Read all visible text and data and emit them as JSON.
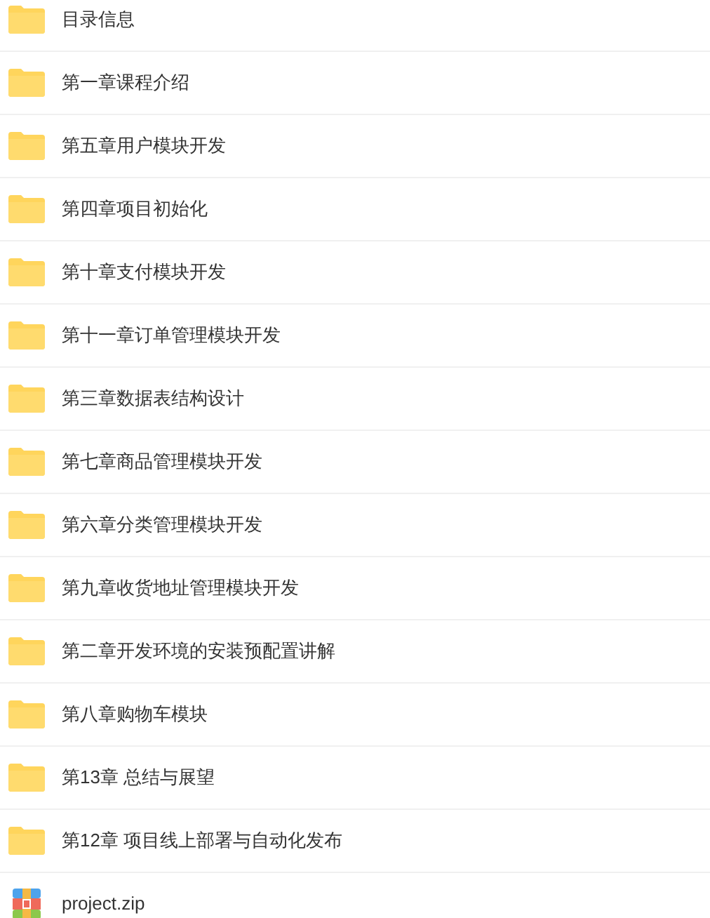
{
  "files": [
    {
      "name": "目录信息",
      "kind": "folder"
    },
    {
      "name": "第一章课程介绍",
      "kind": "folder"
    },
    {
      "name": "第五章用户模块开发",
      "kind": "folder"
    },
    {
      "name": "第四章项目初始化",
      "kind": "folder"
    },
    {
      "name": "第十章支付模块开发",
      "kind": "folder"
    },
    {
      "name": "第十一章订单管理模块开发",
      "kind": "folder"
    },
    {
      "name": "第三章数据表结构设计",
      "kind": "folder"
    },
    {
      "name": "第七章商品管理模块开发",
      "kind": "folder"
    },
    {
      "name": "第六章分类管理模块开发",
      "kind": "folder"
    },
    {
      "name": "第九章收货地址管理模块开发",
      "kind": "folder"
    },
    {
      "name": "第二章开发环境的安装预配置讲解",
      "kind": "folder"
    },
    {
      "name": "第八章购物车模块",
      "kind": "folder"
    },
    {
      "name": "第13章 总结与展望",
      "kind": "folder"
    },
    {
      "name": "第12章 项目线上部署与自动化发布",
      "kind": "folder"
    },
    {
      "name": "project.zip",
      "kind": "zip"
    }
  ]
}
